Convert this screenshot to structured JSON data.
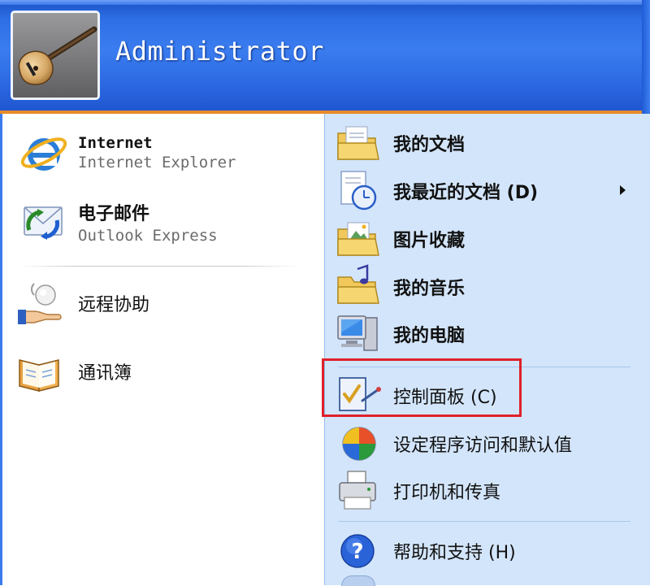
{
  "user": {
    "name": "Administrator"
  },
  "pinned": [
    {
      "title": "Internet",
      "subtitle": "Internet Explorer",
      "icon": "internet-explorer-icon"
    },
    {
      "title": "电子邮件",
      "subtitle": "Outlook Express",
      "icon": "outlook-express-icon"
    }
  ],
  "recent": [
    {
      "label": "远程协助",
      "icon": "remote-assistance-icon"
    },
    {
      "label": "通讯簿",
      "icon": "address-book-icon"
    }
  ],
  "places": [
    {
      "label": "我的文档",
      "icon": "my-documents-icon"
    },
    {
      "label": "我最近的文档 (D)",
      "icon": "recent-documents-icon",
      "submenu": true
    },
    {
      "label": "图片收藏",
      "icon": "my-pictures-icon"
    },
    {
      "label": "我的音乐",
      "icon": "my-music-icon"
    },
    {
      "label": "我的电脑",
      "icon": "my-computer-icon"
    },
    {
      "label": "控制面板 (C)",
      "icon": "control-panel-icon",
      "highlighted": true
    },
    {
      "label": "设定程序访问和默认值",
      "icon": "set-program-access-icon"
    },
    {
      "label": "打印机和传真",
      "icon": "printers-faxes-icon"
    },
    {
      "label": "帮助和支持 (H)",
      "icon": "help-support-icon"
    }
  ],
  "colors": {
    "header_blue": "#2f6fe6",
    "right_pane": "#d3e5fa",
    "accent_orange": "#e58a2b",
    "highlight_red": "#e0202a"
  }
}
